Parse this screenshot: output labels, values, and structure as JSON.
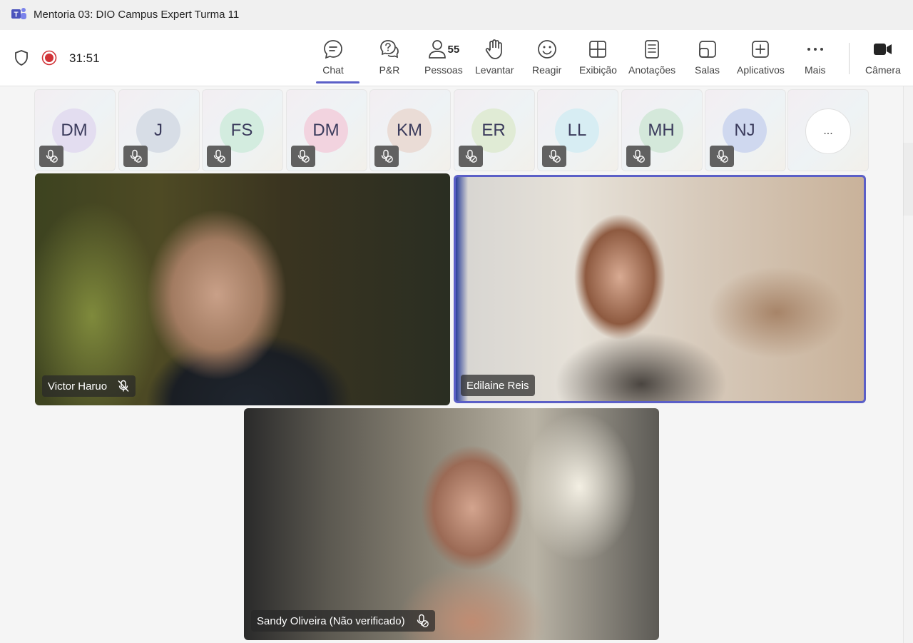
{
  "window": {
    "title": "Mentoria 03: DIO Campus Expert Turma 11"
  },
  "meeting": {
    "timer": "31:51"
  },
  "toolbar": {
    "chat": "Chat",
    "qa": "P&R",
    "people": "Pessoas",
    "people_count": "55",
    "raise": "Levantar",
    "react": "Reagir",
    "view": "Exibição",
    "notes": "Anotações",
    "rooms": "Salas",
    "apps": "Aplicativos",
    "more": "Mais",
    "camera": "Câmera"
  },
  "participants": [
    {
      "initials": "DM",
      "color": "#e3ddf0"
    },
    {
      "initials": "J",
      "color": "#d7dde6"
    },
    {
      "initials": "FS",
      "color": "#d3ecdf"
    },
    {
      "initials": "DM",
      "color": "#f2d3df"
    },
    {
      "initials": "KM",
      "color": "#eadcd6"
    },
    {
      "initials": "ER",
      "color": "#e0ebd5"
    },
    {
      "initials": "LL",
      "color": "#d7edf3"
    },
    {
      "initials": "MH",
      "color": "#d4e8da"
    },
    {
      "initials": "NJ",
      "color": "#cfd8ef"
    }
  ],
  "more_participants": "...",
  "videos": [
    {
      "name": "Victor Haruo"
    },
    {
      "name": "Edilaine Reis"
    },
    {
      "name": "Sandy Oliveira (Não verificado)"
    }
  ],
  "colors": {
    "accent": "#5b5fc7",
    "record": "#d13438"
  }
}
